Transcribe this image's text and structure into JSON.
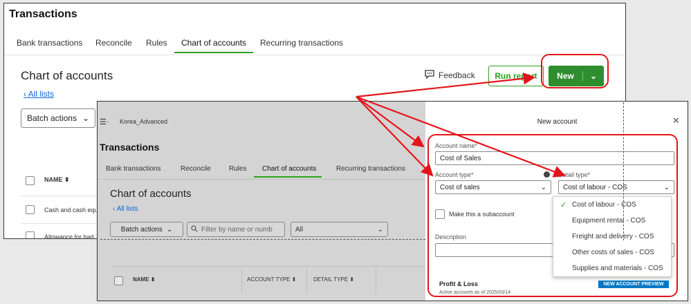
{
  "back": {
    "page_title": "Transactions",
    "tabs": [
      {
        "label": "Bank transactions"
      },
      {
        "label": "Reconcile"
      },
      {
        "label": "Rules"
      },
      {
        "label": "Chart of accounts"
      },
      {
        "label": "Recurring transactions"
      }
    ],
    "heading": "Chart of accounts",
    "all_lists": "All lists",
    "feedback": "Feedback",
    "run_report": "Run report",
    "new_label": "New",
    "batch_actions": "Batch actions",
    "col_name": "NAME",
    "rows": [
      "Cash and cash equ",
      "Allowance for bad"
    ]
  },
  "front": {
    "company": "Korea_Advanced",
    "page_title": "Transactions",
    "tabs": [
      {
        "label": "Bank transactions"
      },
      {
        "label": "Reconcile"
      },
      {
        "label": "Rules"
      },
      {
        "label": "Chart of accounts"
      },
      {
        "label": "Recurring transactions"
      }
    ],
    "heading": "Chart of accounts",
    "all_lists": "All lists",
    "batch_actions": "Batch actions",
    "filter_placeholder": "Filter by name or numb",
    "all_select": "All",
    "columns": {
      "name": "NAME",
      "account_type": "ACCOUNT TYPE",
      "detail_type": "DETAIL TYPE"
    }
  },
  "panel": {
    "title": "New account",
    "account_name_label": "Account name*",
    "account_name_value": "Cost of Sales",
    "account_type_label": "Account type*",
    "account_type_value": "Cost of sales",
    "detail_type_label": "Detail type*",
    "detail_type_value": "Cost of labour - COS",
    "subaccount_label": "Make this a subaccount",
    "description_label": "Description",
    "detail_options": [
      {
        "label": "Cost of labour - COS"
      },
      {
        "label": "Equipment rental - COS"
      },
      {
        "label": "Freight and delivery - COS"
      },
      {
        "label": "Other costs of sales - COS"
      },
      {
        "label": "Supplies and materials - COS"
      }
    ],
    "profit_loss": "Profit & Loss",
    "active_as_of": "Active accounts as of 2025/03/14",
    "preview_badge": "NEW ACCOUNT PREVIEW"
  },
  "colors": {
    "accent_green": "#2ca01c",
    "button_green": "#2e8e2e",
    "annotation_red": "#e4141a",
    "link_blue": "#0b66d6"
  }
}
